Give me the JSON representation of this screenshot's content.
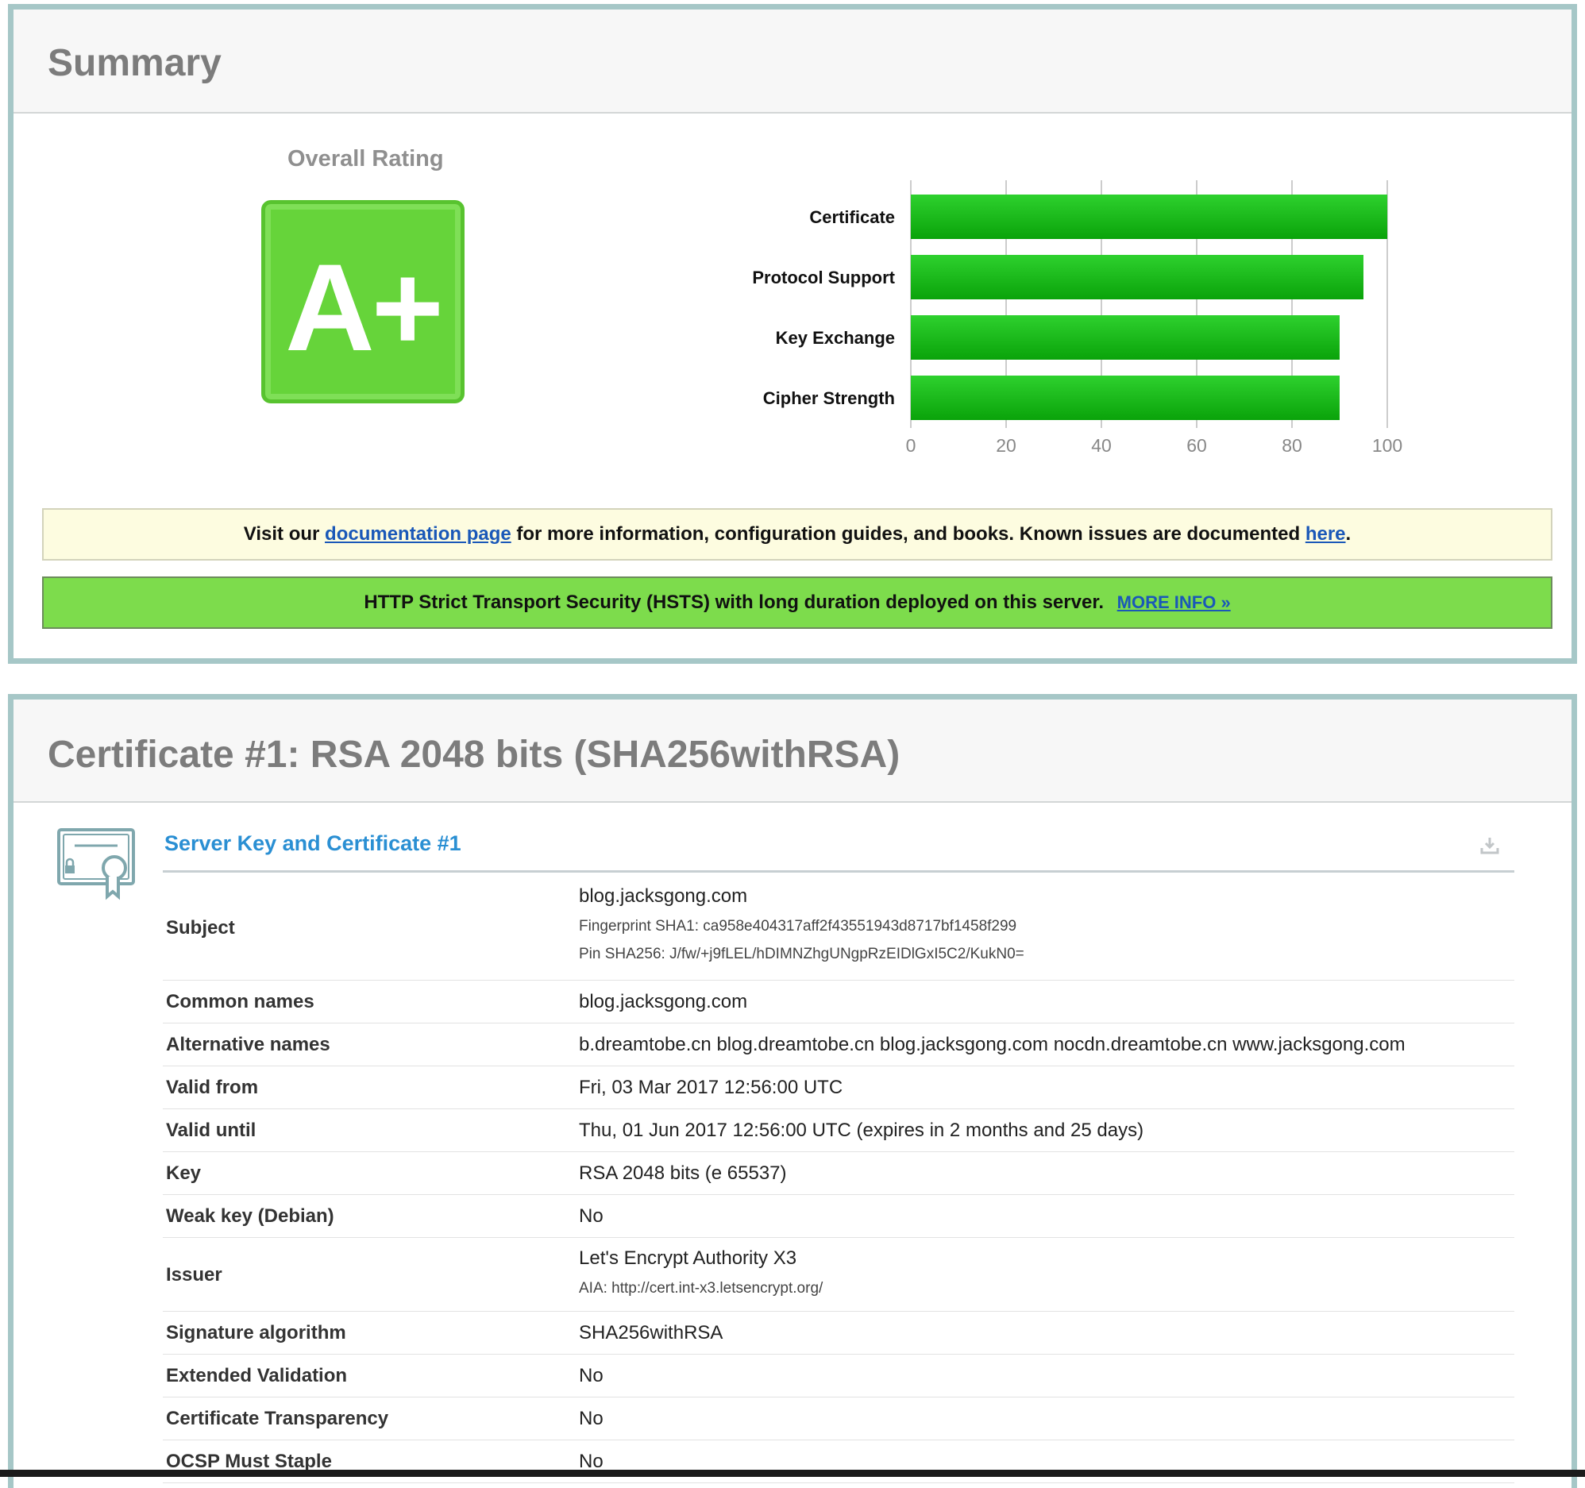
{
  "summary": {
    "title": "Summary",
    "rating_label": "Overall Rating",
    "grade": "A+",
    "notice_doc": {
      "before": "Visit our ",
      "link1": "documentation page",
      "middle": " for more information, configuration guides, and books. Known issues are documented ",
      "link2": "here",
      "after": "."
    },
    "notice_hsts": {
      "text": "HTTP Strict Transport Security (HSTS) with long duration deployed on this server.",
      "link": "MORE INFO »"
    }
  },
  "chart_data": {
    "type": "bar",
    "orientation": "horizontal",
    "categories": [
      "Certificate",
      "Protocol Support",
      "Key Exchange",
      "Cipher Strength"
    ],
    "values": [
      100,
      95,
      90,
      90
    ],
    "xlim": [
      0,
      100
    ],
    "x_ticks": [
      "0",
      "20",
      "40",
      "60",
      "80",
      "100"
    ],
    "grid": true,
    "bar_color": "#11b511"
  },
  "certificate": {
    "title": "Certificate #1: RSA 2048 bits (SHA256withRSA)",
    "section_title": "Server Key and Certificate #1",
    "rows": [
      {
        "key": "Subject",
        "value": "blog.jacksgong.com",
        "subs": [
          "Fingerprint SHA1: ca958e404317aff2f43551943d8717bf1458f299",
          "Pin SHA256: J/fw/+j9fLEL/hDIMNZhgUNgpRzEIDlGxI5C2/KukN0="
        ]
      },
      {
        "key": "Common names",
        "value": "blog.jacksgong.com",
        "subs": []
      },
      {
        "key": "Alternative names",
        "value": "b.dreamtobe.cn blog.dreamtobe.cn blog.jacksgong.com nocdn.dreamtobe.cn www.jacksgong.com",
        "subs": []
      },
      {
        "key": "Valid from",
        "value": "Fri, 03 Mar 2017 12:56:00 UTC",
        "subs": []
      },
      {
        "key": "Valid until",
        "value": "Thu, 01 Jun 2017 12:56:00 UTC (expires in 2 months and 25 days)",
        "subs": []
      },
      {
        "key": "Key",
        "value": "RSA 2048 bits (e 65537)",
        "subs": []
      },
      {
        "key": "Weak key (Debian)",
        "value": "No",
        "subs": []
      },
      {
        "key": "Issuer",
        "value": "Let's Encrypt Authority X3",
        "subs": [
          "AIA: http://cert.int-x3.letsencrypt.org/"
        ]
      },
      {
        "key": "Signature algorithm",
        "value": "SHA256withRSA",
        "subs": []
      },
      {
        "key": "Extended Validation",
        "value": "No",
        "subs": []
      },
      {
        "key": "Certificate Transparency",
        "value": "No",
        "subs": []
      },
      {
        "key": "OCSP Must Staple",
        "value": "No",
        "subs": []
      }
    ]
  },
  "icons": {
    "certificate": "certificate-icon",
    "download": "download-icon"
  }
}
